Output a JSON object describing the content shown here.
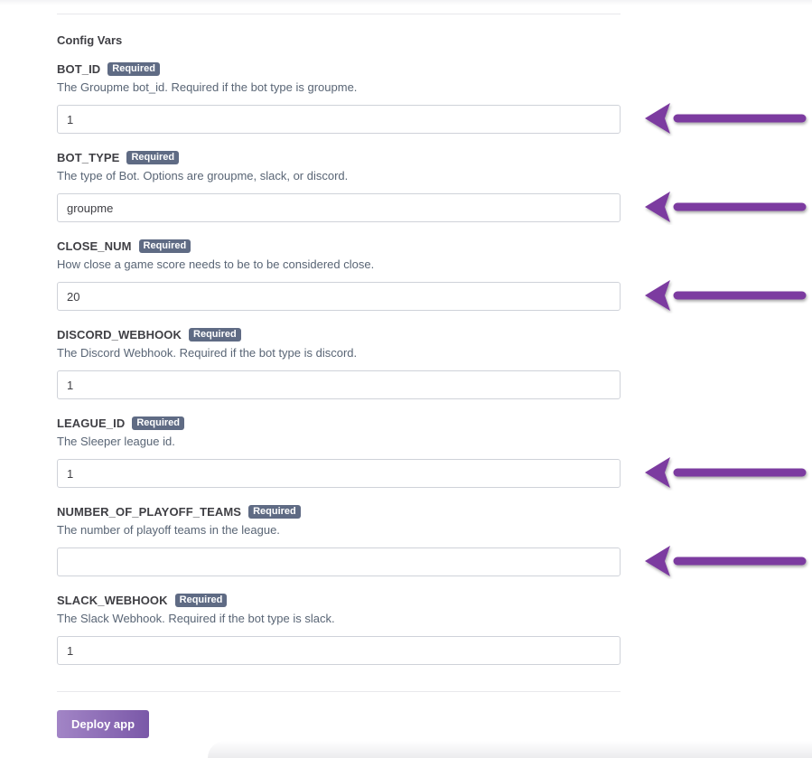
{
  "section_title": "Config Vars",
  "required_badge": "Required",
  "fields": [
    {
      "key": "BOT_ID",
      "badge": "Required",
      "description": "The Groupme bot_id. Required if the bot type is groupme.",
      "value": "1",
      "arrow": true
    },
    {
      "key": "BOT_TYPE",
      "badge": "Required",
      "description": "The type of Bot. Options are groupme, slack, or discord.",
      "value": "groupme",
      "arrow": true
    },
    {
      "key": "CLOSE_NUM",
      "badge": "Required",
      "description": "How close a game score needs to be to be considered close.",
      "value": "20",
      "arrow": true
    },
    {
      "key": "DISCORD_WEBHOOK",
      "badge": "Required",
      "description": "The Discord Webhook. Required if the bot type is discord.",
      "value": "1",
      "arrow": false
    },
    {
      "key": "LEAGUE_ID",
      "badge": "Required",
      "description": "The Sleeper league id.",
      "value": "1",
      "arrow": true
    },
    {
      "key": "NUMBER_OF_PLAYOFF_TEAMS",
      "badge": "Required",
      "description": "The number of playoff teams in the league.",
      "value": "",
      "arrow": true
    },
    {
      "key": "SLACK_WEBHOOK",
      "badge": "Required",
      "description": "The Slack Webhook. Required if the bot type is slack.",
      "value": "1",
      "arrow": false
    }
  ],
  "deploy_button": "Deploy app",
  "annotation": {
    "arrow_color": "#7b3aa0",
    "arrow_icon": "arrow-left-icon"
  }
}
